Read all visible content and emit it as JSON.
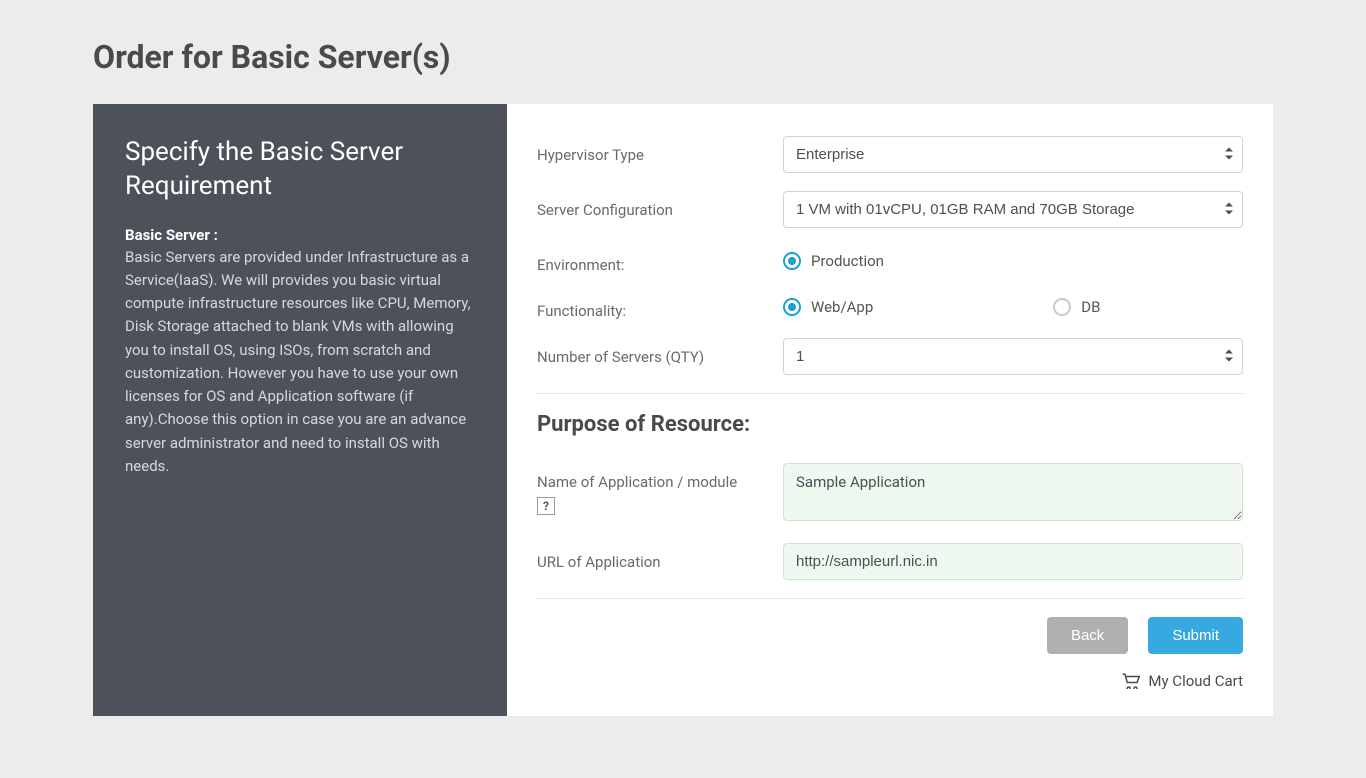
{
  "page": {
    "title": "Order for Basic Server(s)"
  },
  "sidebar": {
    "heading": "Specify the Basic Server Requirement",
    "subhead": "Basic Server :",
    "description": "Basic Servers are provided under Infrastructure as a Service(IaaS). We will provides you basic virtual compute infrastructure resources like CPU, Memory, Disk Storage attached to blank VMs with allowing you to install OS, using ISOs, from scratch and customization. However you have to use your own licenses for OS and Application software (if any).Choose this option in case you are an advance server administrator and need to install OS with needs."
  },
  "form": {
    "hypervisor": {
      "label": "Hypervisor Type",
      "selected": "Enterprise"
    },
    "serverConfig": {
      "label": "Server Configuration",
      "selected": "1 VM with 01vCPU, 01GB RAM and 70GB Storage"
    },
    "environment": {
      "label": "Environment:",
      "options": [
        {
          "label": "Production",
          "checked": true
        }
      ]
    },
    "functionality": {
      "label": "Functionality:",
      "options": [
        {
          "label": "Web/App",
          "checked": true
        },
        {
          "label": "DB",
          "checked": false
        }
      ]
    },
    "quantity": {
      "label": "Number of Servers (QTY)",
      "selected": "1"
    },
    "purposeHeading": "Purpose of Resource:",
    "appName": {
      "label": "Name of Application / module",
      "value": "Sample Application",
      "help": "?"
    },
    "appUrl": {
      "label": "URL of Application",
      "value": "http://sampleurl.nic.in"
    }
  },
  "actions": {
    "back": "Back",
    "submit": "Submit",
    "cart": "My Cloud Cart"
  }
}
